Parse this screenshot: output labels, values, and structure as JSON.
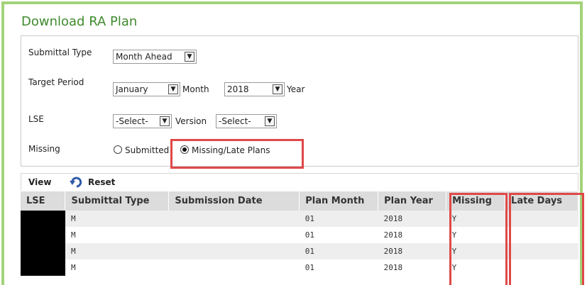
{
  "title": "Download RA Plan",
  "form": {
    "submittal_type_label": "Submittal Type",
    "submittal_type_value": "Month Ahead",
    "target_period_label": "Target Period",
    "month_value": "January",
    "month_label": "Month",
    "year_value": "2018",
    "year_label": "Year",
    "lse_label": "LSE",
    "lse_value": "-Select-",
    "version_label": "Version",
    "version_value": "-Select-",
    "missing_label": "Missing",
    "radio_submitted": "Submitted",
    "radio_missing": "Missing/Late Plans",
    "selected_radio": "Missing/Late Plans"
  },
  "toolbar": {
    "view_label": "View",
    "reset_label": "Reset"
  },
  "table": {
    "columns": [
      "LSE",
      "Submittal Type",
      "Submission Date",
      "Plan Month",
      "Plan Year",
      "Missing",
      "Late Days"
    ],
    "rows": [
      {
        "lse": "",
        "submittal_type": "M",
        "submission_date": "",
        "plan_month": "01",
        "plan_year": "2018",
        "missing": "Y",
        "late_days": ""
      },
      {
        "lse": "",
        "submittal_type": "M",
        "submission_date": "",
        "plan_month": "01",
        "plan_year": "2018",
        "missing": "Y",
        "late_days": ""
      },
      {
        "lse": "",
        "submittal_type": "M",
        "submission_date": "",
        "plan_month": "01",
        "plan_year": "2018",
        "missing": "Y",
        "late_days": ""
      },
      {
        "lse": "",
        "submittal_type": "M",
        "submission_date": "",
        "plan_month": "01",
        "plan_year": "2018",
        "missing": "Y",
        "late_days": ""
      }
    ]
  },
  "colors": {
    "title": "#3f8a2d",
    "frame": "#a3d37a",
    "highlight": "#e04848",
    "header_bg": "#dcdcdc",
    "alt_row_bg": "#eeeeee"
  }
}
